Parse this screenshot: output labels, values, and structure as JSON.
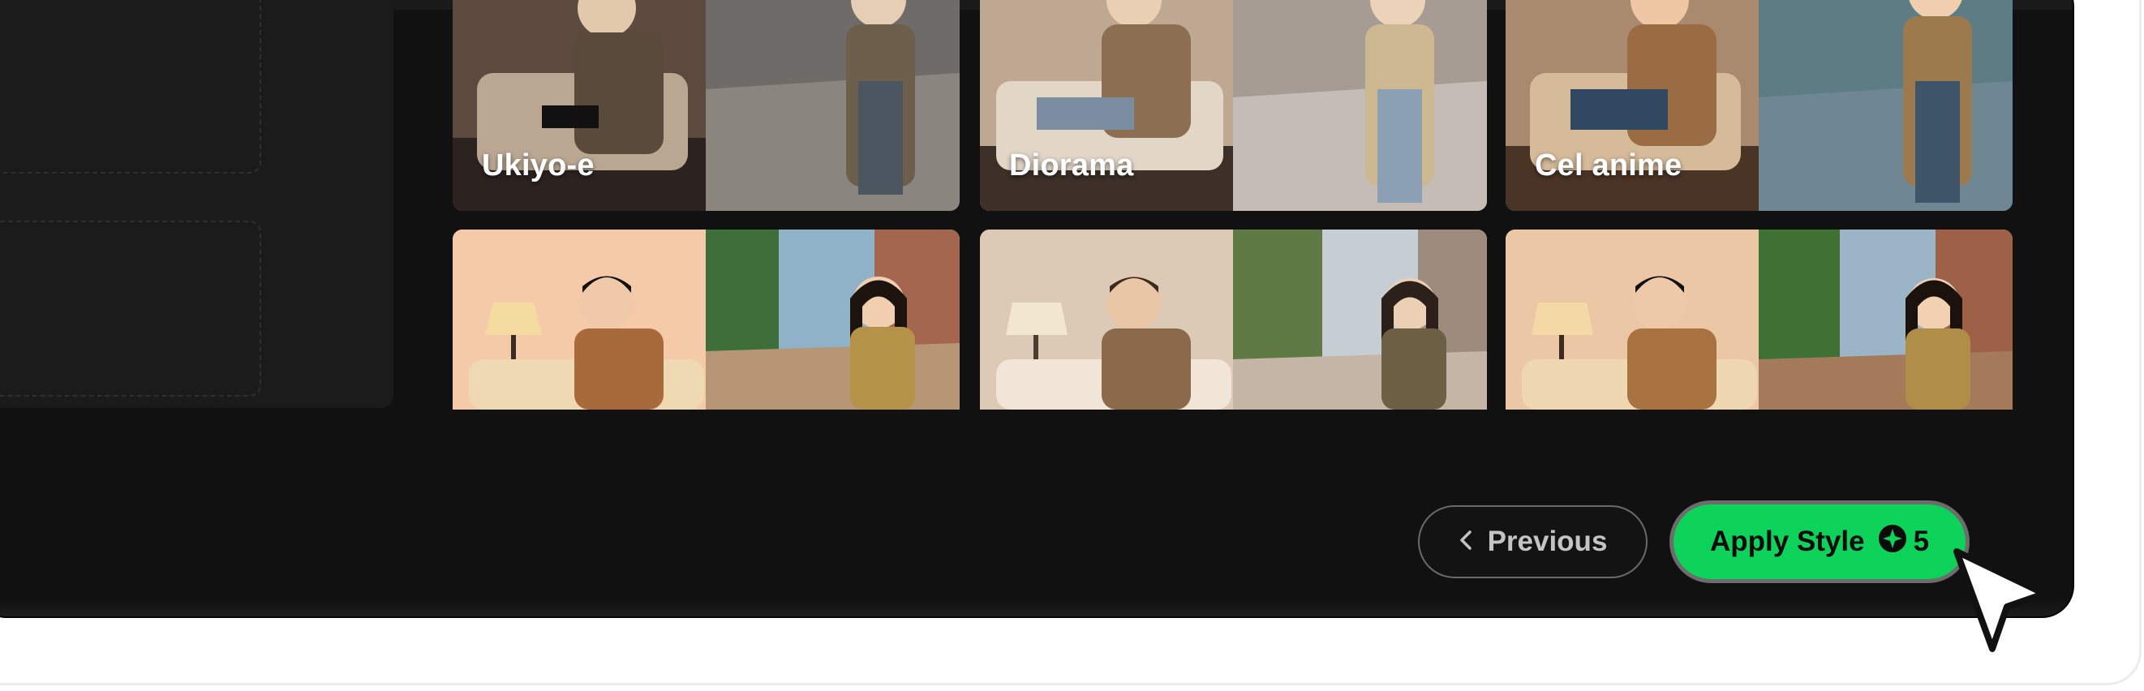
{
  "styles_grid": {
    "tiles": [
      {
        "label": "Ukiyo-e"
      },
      {
        "label": "Diorama"
      },
      {
        "label": "Cel anime"
      },
      {
        "label": ""
      },
      {
        "label": ""
      },
      {
        "label": ""
      }
    ]
  },
  "footer": {
    "previous_label": "Previous",
    "previous_icon": "chevron-left-icon",
    "apply_label": "Apply Style",
    "credit_icon": "credit-coin-icon",
    "credit_cost": "5"
  },
  "colors": {
    "app_background": "#111111",
    "apply_button": "#0dd35a",
    "apply_button_text": "#0b0b0b",
    "previous_text": "#c4c4c4"
  }
}
